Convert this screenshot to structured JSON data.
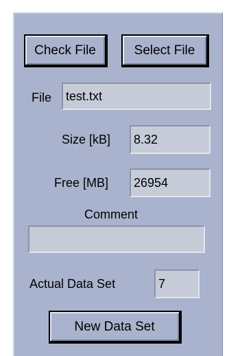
{
  "buttons": {
    "check_file": "Check File",
    "select_file": "Select File",
    "new_data_set": "New Data Set"
  },
  "fields": {
    "file": {
      "label": "File",
      "value": "test.txt"
    },
    "size": {
      "label": "Size [kB]",
      "value": "8.32"
    },
    "free": {
      "label": "Free [MB]",
      "value": "26954"
    },
    "comment": {
      "label": "Comment",
      "value": ""
    },
    "actual_data_set": {
      "label": "Actual Data Set",
      "value": "7"
    }
  },
  "colors": {
    "panel": "#a9b3cd",
    "field": "#c6cbd8"
  }
}
